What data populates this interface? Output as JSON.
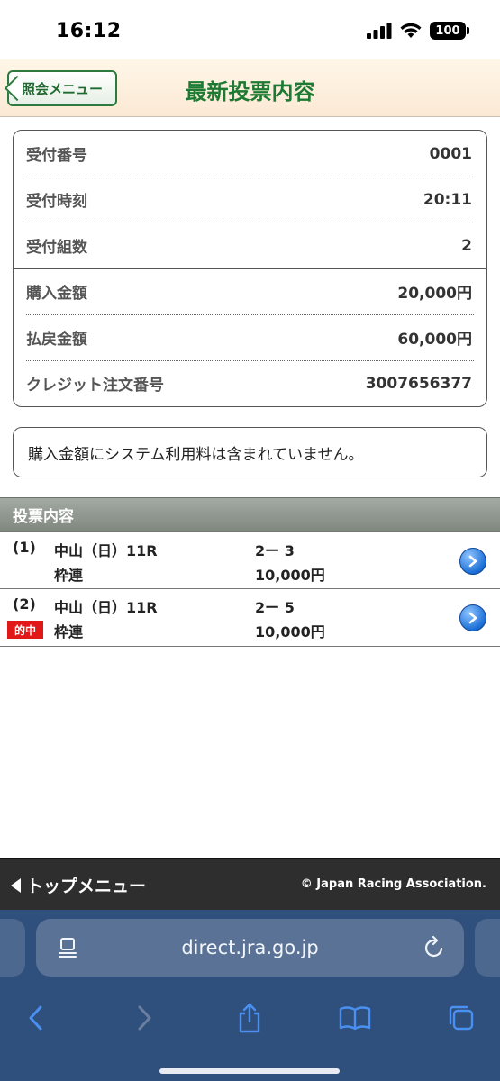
{
  "status_bar": {
    "time": "16:12",
    "battery": "100"
  },
  "header": {
    "back_label": "照会メニュー",
    "title": "最新投票内容"
  },
  "receipt": {
    "rows": [
      {
        "label": "受付番号",
        "value": "0001"
      },
      {
        "label": "受付時刻",
        "value": "20:11"
      },
      {
        "label": "受付組数",
        "value": "2"
      },
      {
        "label": "購入金額",
        "value": "20,000円"
      },
      {
        "label": "払戻金額",
        "value": "60,000円"
      },
      {
        "label": "クレジット注文番号",
        "value": "3007656377"
      }
    ]
  },
  "notice": "購入金額にシステム利用料は含まれていません。",
  "section": {
    "title": "投票内容"
  },
  "votes": [
    {
      "num": "(1)",
      "race": "中山（日）11R",
      "kind": "枠連",
      "combo": "2ー 3",
      "amount": "10,000円",
      "hit": ""
    },
    {
      "num": "(2)",
      "race": "中山（日）11R",
      "kind": "枠連",
      "combo": "2ー 5",
      "amount": "10,000円",
      "hit": "的中"
    }
  ],
  "footer": {
    "top_menu": "トップメニュー",
    "copyright": "© Japan Racing Association."
  },
  "browser": {
    "url": "direct.jra.go.jp"
  }
}
